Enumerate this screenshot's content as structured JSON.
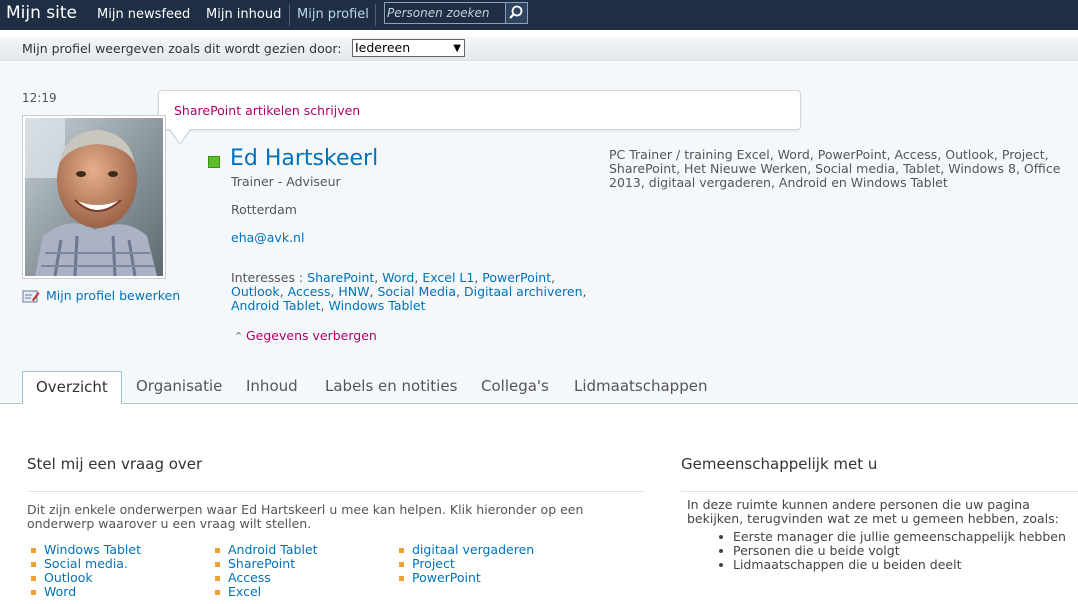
{
  "topbar": {
    "site_title": "Mijn site",
    "nav": [
      "Mijn newsfeed",
      "Mijn inhoud",
      "Mijn profiel"
    ],
    "search_placeholder": "Personen zoeken"
  },
  "viewbar": {
    "label": "Mijn profiel weergeven zoals dit wordt gezien door:",
    "selected": "Iedereen"
  },
  "profile": {
    "time": "12:19",
    "status": "SharePoint artikelen schrijven",
    "name": "Ed Hartskeerl",
    "job_title": "Trainer - Adviseur",
    "location": "Rotterdam",
    "email": "eha@avk.nl",
    "interests_label": "Interesses :",
    "interests": [
      "SharePoint",
      "Word",
      "Excel L1",
      "PowerPoint",
      "Outlook",
      "Access",
      "HNW",
      "Social Media",
      "Digitaal archiveren",
      "Android Tablet",
      "Windows Tablet"
    ],
    "hide_details": "Gegevens verbergen",
    "edit_profile": "Mijn profiel bewerken",
    "about": "PC Trainer / training Excel, Word, PowerPoint, Access, Outlook, Project, SharePoint, Het Nieuwe Werken, Social media, Tablet, Windows 8, Office 2013, digitaal vergaderen, Android en Windows Tablet"
  },
  "tabs": [
    "Overzicht",
    "Organisatie",
    "Inhoud",
    "Labels en notities",
    "Collega's",
    "Lidmaatschappen"
  ],
  "ask": {
    "title": "Stel mij een vraag over",
    "description": "Dit zijn enkele onderwerpen waar Ed Hartskeerl u mee kan helpen. Klik hieronder op een onderwerp waarover u een vraag wilt stellen.",
    "columns": [
      [
        "Windows Tablet",
        "Social media.",
        "Outlook",
        "Word"
      ],
      [
        "Android Tablet",
        "SharePoint",
        "Access",
        "Excel"
      ],
      [
        "digitaal vergaderen",
        "Project",
        "PowerPoint"
      ]
    ]
  },
  "common": {
    "title": "Gemeenschappelijk met u",
    "description": "In deze ruimte kunnen andere personen die uw pagina bekijken, terugvinden wat ze met u gemeen hebben, zoals:",
    "items": [
      "Eerste manager die jullie gemeenschappelijk hebben",
      "Personen die u beide volgt",
      "Lidmaatschappen die u beiden deelt"
    ]
  },
  "colors": {
    "topbar": "#1e2e44",
    "link": "#0072bc",
    "accent": "#b0006a",
    "presence": "#5cbf2a",
    "bullet": "#f0a030"
  }
}
